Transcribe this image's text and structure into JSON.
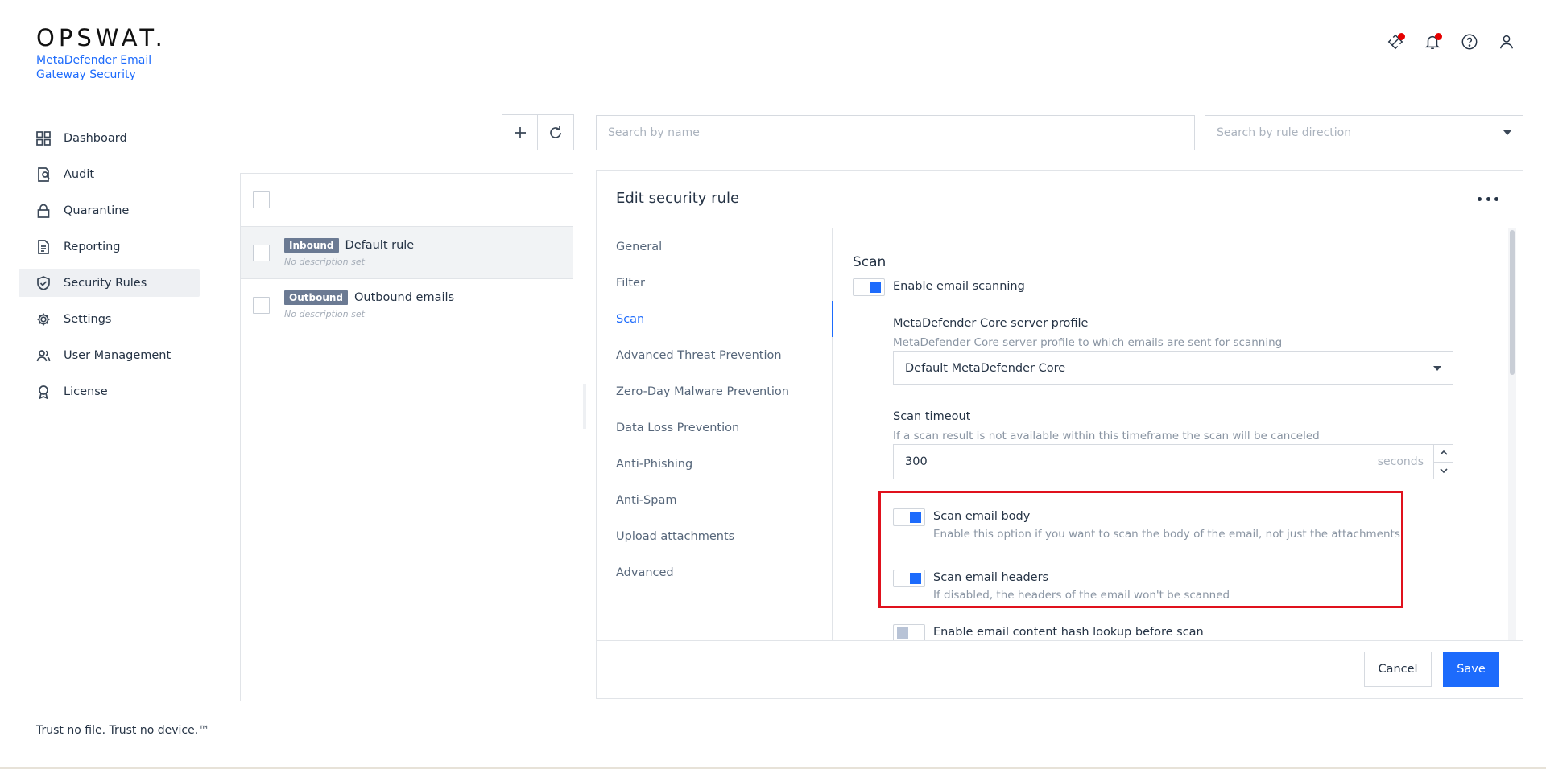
{
  "brand": {
    "logo": "OPSWAT.",
    "product_line1": "MetaDefender Email",
    "product_line2": "Gateway Security"
  },
  "header_icons": [
    {
      "name": "integration-icon",
      "has_alert": true
    },
    {
      "name": "bell-icon",
      "has_alert": true
    },
    {
      "name": "help-icon",
      "has_alert": false
    },
    {
      "name": "user-icon",
      "has_alert": false
    }
  ],
  "sidebar": {
    "items": [
      {
        "label": "Dashboard",
        "icon": "dashboard-icon",
        "active": false
      },
      {
        "label": "Audit",
        "icon": "audit-icon",
        "active": false
      },
      {
        "label": "Quarantine",
        "icon": "lock-icon",
        "active": false
      },
      {
        "label": "Reporting",
        "icon": "report-icon",
        "active": false
      },
      {
        "label": "Security Rules",
        "icon": "shield-check-icon",
        "active": true
      },
      {
        "label": "Settings",
        "icon": "gear-icon",
        "active": false
      },
      {
        "label": "User Management",
        "icon": "users-icon",
        "active": false
      },
      {
        "label": "License",
        "icon": "badge-icon",
        "active": false
      }
    ]
  },
  "footer": "Trust no file. Trust no device.™",
  "rules": {
    "items": [
      {
        "direction": "Inbound",
        "name": "Default rule",
        "description": "No description set",
        "selected": true
      },
      {
        "direction": "Outbound",
        "name": "Outbound emails",
        "description": "No description set",
        "selected": false
      }
    ]
  },
  "search": {
    "placeholder": "Search by name",
    "direction_placeholder": "Search by rule direction"
  },
  "edit": {
    "title": "Edit security rule",
    "sections": [
      "General",
      "Filter",
      "Scan",
      "Advanced Threat Prevention",
      "Zero-Day Malware Prevention",
      "Data Loss Prevention",
      "Anti-Phishing",
      "Anti-Spam",
      "Upload attachments",
      "Advanced"
    ],
    "active_section": "Scan",
    "scan": {
      "heading": "Scan",
      "enable_scanning": {
        "label": "Enable email scanning",
        "on": true
      },
      "profile": {
        "label": "MetaDefender Core server profile",
        "description": "MetaDefender Core server profile to which emails are sent for scanning",
        "value": "Default MetaDefender Core"
      },
      "timeout": {
        "label": "Scan timeout",
        "description": "If a scan result is not available within this timeframe the scan will be canceled",
        "value": "300",
        "unit": "seconds"
      },
      "scan_body": {
        "label": "Scan email body",
        "description": "Enable this option if you want to scan the body of the email, not just the attachments",
        "on": true
      },
      "scan_headers": {
        "label": "Scan email headers",
        "description": "If disabled, the headers of the email won't be scanned",
        "on": true
      },
      "hash_lookup": {
        "label": "Enable email content hash lookup before scan",
        "on": false
      }
    },
    "cancel_label": "Cancel",
    "save_label": "Save"
  },
  "colors": {
    "accent": "#1d6bfc",
    "highlight": "#e0111d",
    "tag": "#6b7a93",
    "alert_dot": "#e60000"
  }
}
